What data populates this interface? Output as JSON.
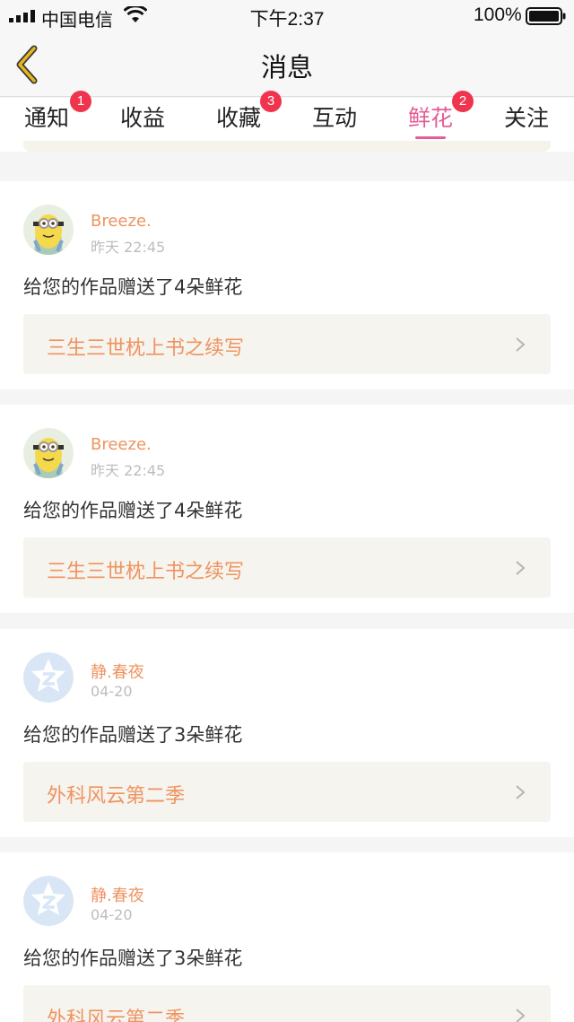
{
  "status_bar": {
    "carrier": "中国电信",
    "time": "下午2:37",
    "battery_percent": "100%"
  },
  "nav": {
    "title": "消息",
    "back_icon": "chevron-left-icon"
  },
  "tabs": [
    {
      "label": "通知",
      "badge": "1"
    },
    {
      "label": "收益",
      "badge": ""
    },
    {
      "label": "收藏",
      "badge": "3"
    },
    {
      "label": "互动",
      "badge": ""
    },
    {
      "label": "鲜花",
      "badge": "2",
      "active": true
    },
    {
      "label": "关注",
      "badge": ""
    }
  ],
  "messages": [
    {
      "user": "Breeze.",
      "time": "昨天 22:45",
      "text": "给您的作品赠送了4朵鲜花",
      "work": "三生三世枕上书之续写",
      "avatar": "minion-avatar"
    },
    {
      "user": "Breeze.",
      "time": "昨天 22:45",
      "text": "给您的作品赠送了4朵鲜花",
      "work": "三生三世枕上书之续写",
      "avatar": "minion-avatar"
    },
    {
      "user": "静.春夜",
      "time": "04-20",
      "text": "给您的作品赠送了3朵鲜花",
      "work": "外科风云第二季",
      "avatar": "default-avatar"
    },
    {
      "user": "静.春夜",
      "time": "04-20",
      "text": "给您的作品赠送了3朵鲜花",
      "work": "外科风云第二季",
      "avatar": "default-avatar"
    }
  ],
  "colors": {
    "accent": "#e25e97",
    "username": "#ef9360",
    "badge": "#f0344d",
    "back_arrow": "#d4a516"
  }
}
